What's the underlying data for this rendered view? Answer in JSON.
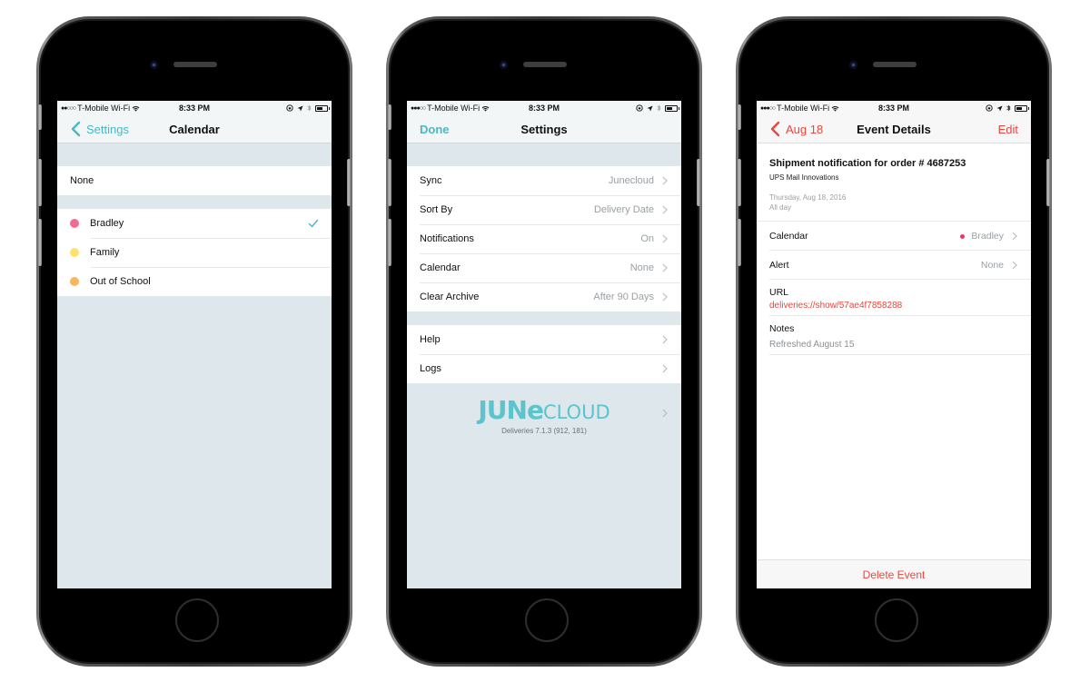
{
  "colors": {
    "accent_teal": "#4ab7c4",
    "accent_red": "#e8473f",
    "screen_bg": "#dde7ec",
    "bradley": "#f26b94",
    "family": "#fde26a",
    "out_of_school": "#fdb65a"
  },
  "status_bar": [
    {
      "signal": "●●○○○",
      "carrier": "T-Mobile Wi-Fi",
      "time": "8:33 PM"
    },
    {
      "signal": "●●●○○",
      "carrier": "T-Mobile Wi-Fi",
      "time": "8:33 PM"
    },
    {
      "signal": "●●●○○",
      "carrier": "T-Mobile Wi-Fi",
      "time": "8:33 PM"
    }
  ],
  "calendar_screen": {
    "back_label": "Settings",
    "title": "Calendar",
    "none_label": "None",
    "calendars": [
      {
        "name": "Bradley",
        "color": "#f26b94",
        "selected": true
      },
      {
        "name": "Family",
        "color": "#fde26a",
        "selected": false
      },
      {
        "name": "Out of School",
        "color": "#fdb65a",
        "selected": false
      }
    ]
  },
  "settings_screen": {
    "done_label": "Done",
    "title": "Settings",
    "rows": [
      {
        "label": "Sync",
        "value": "Junecloud"
      },
      {
        "label": "Sort By",
        "value": "Delivery Date"
      },
      {
        "label": "Notifications",
        "value": "On"
      },
      {
        "label": "Calendar",
        "value": "None"
      },
      {
        "label": "Clear Archive",
        "value": "After 90 Days"
      }
    ],
    "rows2": [
      {
        "label": "Help"
      },
      {
        "label": "Logs"
      }
    ],
    "logo_june": "JUNe",
    "logo_cloud": "CLOUD",
    "version": "Deliveries 7.1.3 (912, 181)"
  },
  "event_screen": {
    "back_label": "Aug 18",
    "title": "Event Details",
    "edit_label": "Edit",
    "event_title": "Shipment notification for order # 4687253",
    "event_subtitle": "UPS Mail Innovations",
    "date": "Thursday, Aug 18, 2016",
    "all_day": "All day",
    "calendar_label": "Calendar",
    "calendar_value": "Bradley",
    "alert_label": "Alert",
    "alert_value": "None",
    "url_label": "URL",
    "url_value": "deliveries://show/57ae4f7858288",
    "notes_label": "Notes",
    "notes_value": "Refreshed August 15",
    "delete_label": "Delete Event"
  }
}
